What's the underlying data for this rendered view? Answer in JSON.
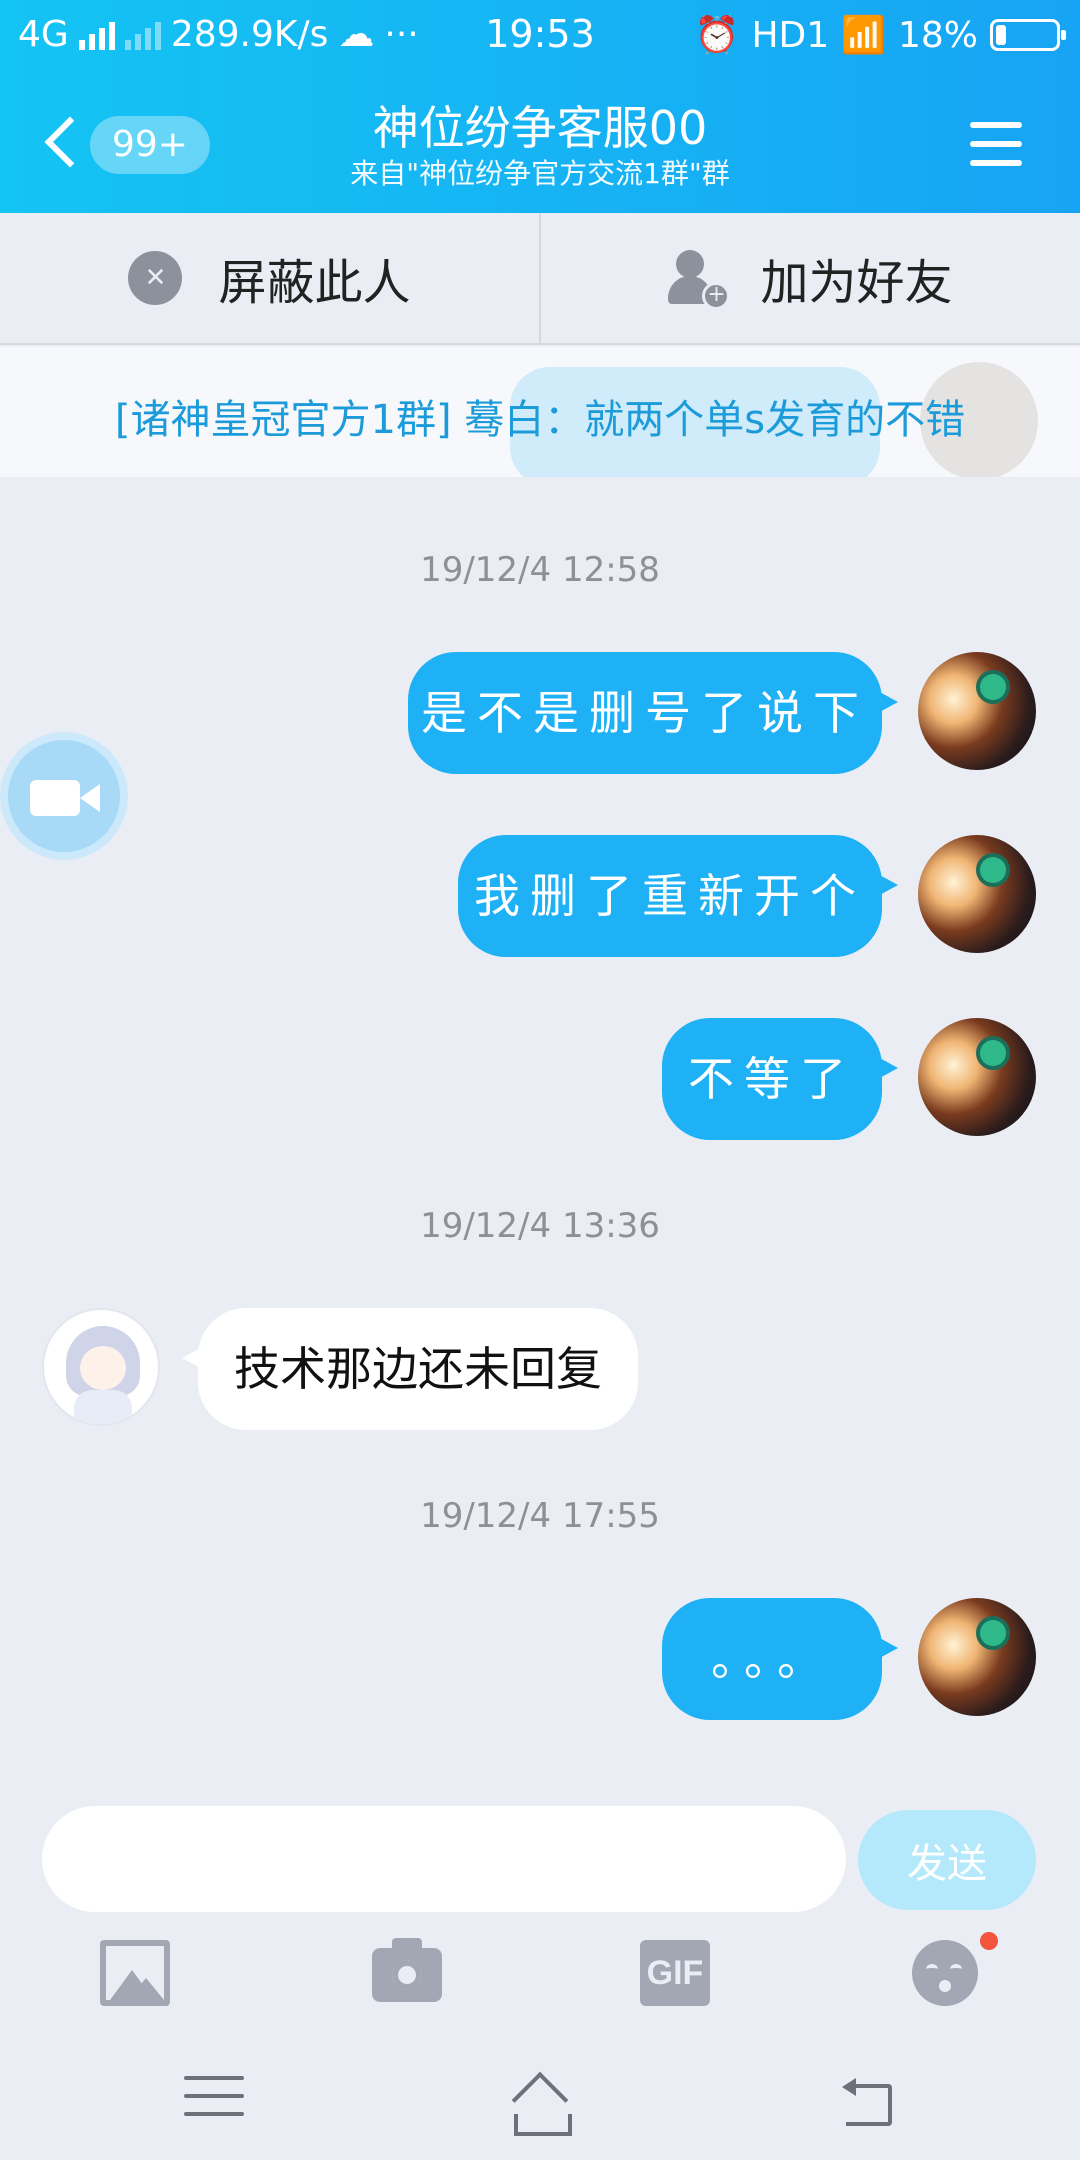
{
  "status_bar": {
    "network": "4G",
    "speed": "289.9K/s",
    "dots": "···",
    "time": "19:53",
    "hd": "HD1",
    "battery_percent_label": "18%",
    "battery_level": 0.18,
    "icons": [
      "signal-icon",
      "cloud-icon",
      "alarm-icon",
      "wifi-icon",
      "battery-icon"
    ]
  },
  "header": {
    "unread_badge": "99+",
    "title": "神位纷争客服00",
    "subtitle": "来自\"神位纷争官方交流1群\"群"
  },
  "actions": {
    "block_label": "屏蔽此人",
    "add_friend_label": "加为好友"
  },
  "notice": {
    "text": "[诸神皇冠官方1群] 蓦白：就两个单s发育的不错"
  },
  "chat": {
    "messages": [
      {
        "type": "timestamp",
        "text": "19/12/4 12:58"
      },
      {
        "type": "outgoing",
        "text": "是不是删号了说下"
      },
      {
        "type": "outgoing",
        "text": "我删了重新开个"
      },
      {
        "type": "outgoing",
        "text": "不等了"
      },
      {
        "type": "timestamp",
        "text": "19/12/4 13:36"
      },
      {
        "type": "incoming",
        "text": "技术那边还未回复"
      },
      {
        "type": "timestamp",
        "text": "19/12/4 17:55"
      },
      {
        "type": "outgoing",
        "text": "。。。"
      }
    ]
  },
  "composer": {
    "input_value": "",
    "input_placeholder": "",
    "send_label": "发送",
    "gif_label": "GIF",
    "tools": [
      "image-icon",
      "camera-icon",
      "gif-icon",
      "emoji-icon"
    ]
  },
  "colors": {
    "header_start": "#14c4f3",
    "header_end": "#17a4f4",
    "outgoing_bubble": "#1fb1f5",
    "notice_text": "#1b9bd9",
    "background": "#eaedf4"
  }
}
